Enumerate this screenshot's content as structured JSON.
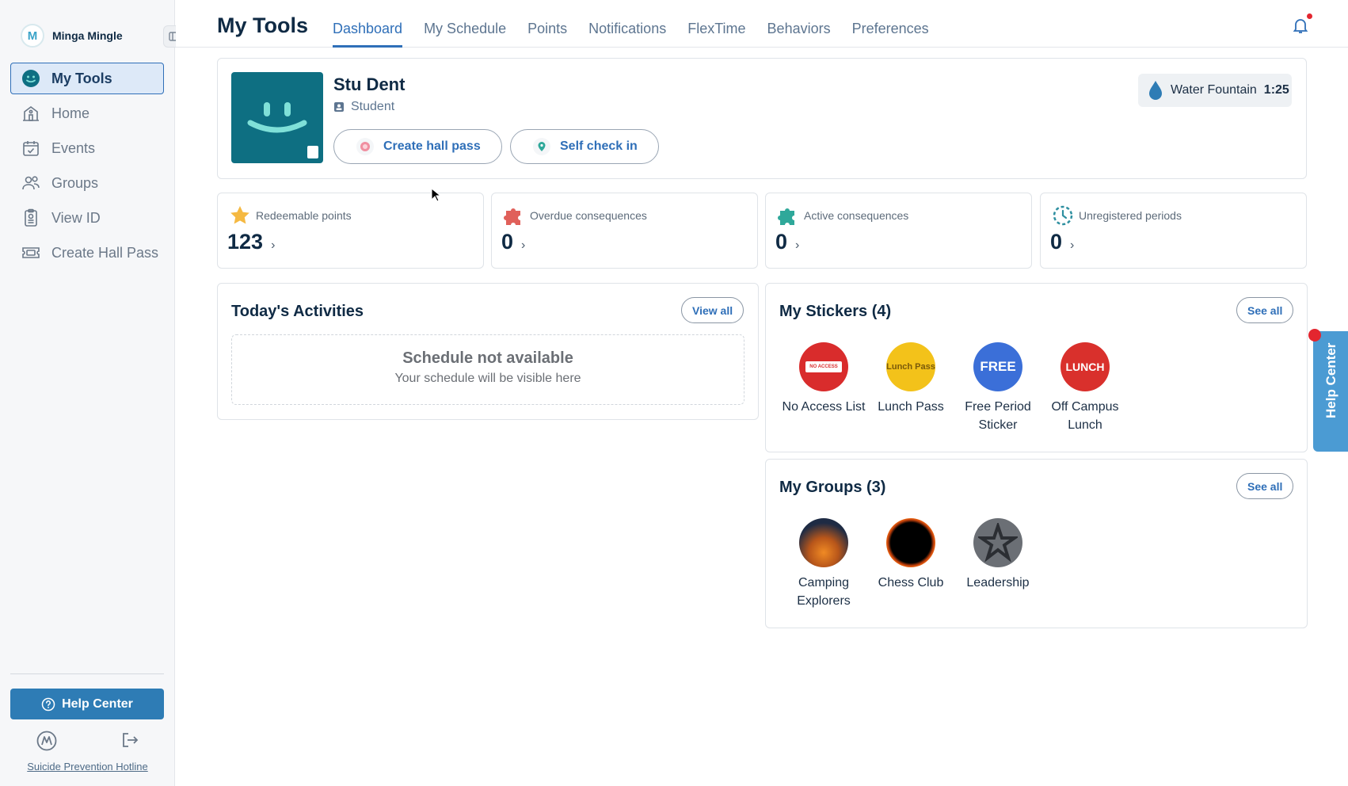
{
  "brand": {
    "name": "Minga Mingle",
    "logo_letter": "M"
  },
  "sidebar": {
    "items": [
      {
        "label": "My Tools",
        "icon": "smiley-icon"
      },
      {
        "label": "Home",
        "icon": "school-icon"
      },
      {
        "label": "Events",
        "icon": "calendar-check-icon"
      },
      {
        "label": "Groups",
        "icon": "people-icon"
      },
      {
        "label": "View ID",
        "icon": "id-badge-icon"
      },
      {
        "label": "Create Hall Pass",
        "icon": "ticket-icon"
      }
    ],
    "help_label": "Help Center",
    "hotline_label": "Suicide Prevention Hotline"
  },
  "header": {
    "title": "My Tools",
    "tabs": [
      "Dashboard",
      "My Schedule",
      "Points",
      "Notifications",
      "FlexTime",
      "Behaviors",
      "Preferences"
    ],
    "active_tab": "Dashboard"
  },
  "profile": {
    "name": "Stu Dent",
    "role": "Student",
    "create_hall_pass_label": "Create hall pass",
    "self_check_in_label": "Self check in",
    "active_pass": {
      "label": "Water Fountain",
      "time": "1:25"
    }
  },
  "stats": [
    {
      "label": "Redeemable points",
      "value": "123",
      "icon": "star-icon",
      "color": "#f5b942"
    },
    {
      "label": "Overdue consequences",
      "value": "0",
      "icon": "puzzle-icon",
      "color": "#e0605a"
    },
    {
      "label": "Active consequences",
      "value": "0",
      "icon": "puzzle-icon",
      "color": "#2fa89a"
    },
    {
      "label": "Unregistered periods",
      "value": "0",
      "icon": "dashed-clock-icon",
      "color": "#2e8fa0"
    }
  ],
  "activities": {
    "title": "Today's Activities",
    "view_all_label": "View all",
    "empty_title": "Schedule not available",
    "empty_subtitle": "Your schedule will be visible here"
  },
  "stickers": {
    "title": "My Stickers (4)",
    "see_all_label": "See all",
    "items": [
      {
        "label": "No Access List",
        "art": "NO ACCESS LIST",
        "color": "#d92c2c"
      },
      {
        "label": "Lunch Pass",
        "art": "Lunch Pass",
        "color": "#f3c21a"
      },
      {
        "label": "Free Period Sticker",
        "art": "FREE",
        "color": "#3b6fd8"
      },
      {
        "label": "Off Campus Lunch",
        "art": "LUNCH",
        "color": "#d9302c"
      }
    ]
  },
  "groups": {
    "title": "My Groups (3)",
    "see_all_label": "See all",
    "items": [
      {
        "label": "Camping Explorers"
      },
      {
        "label": "Chess Club"
      },
      {
        "label": "Leadership"
      }
    ]
  },
  "help_tab": {
    "label": "Help Center"
  }
}
